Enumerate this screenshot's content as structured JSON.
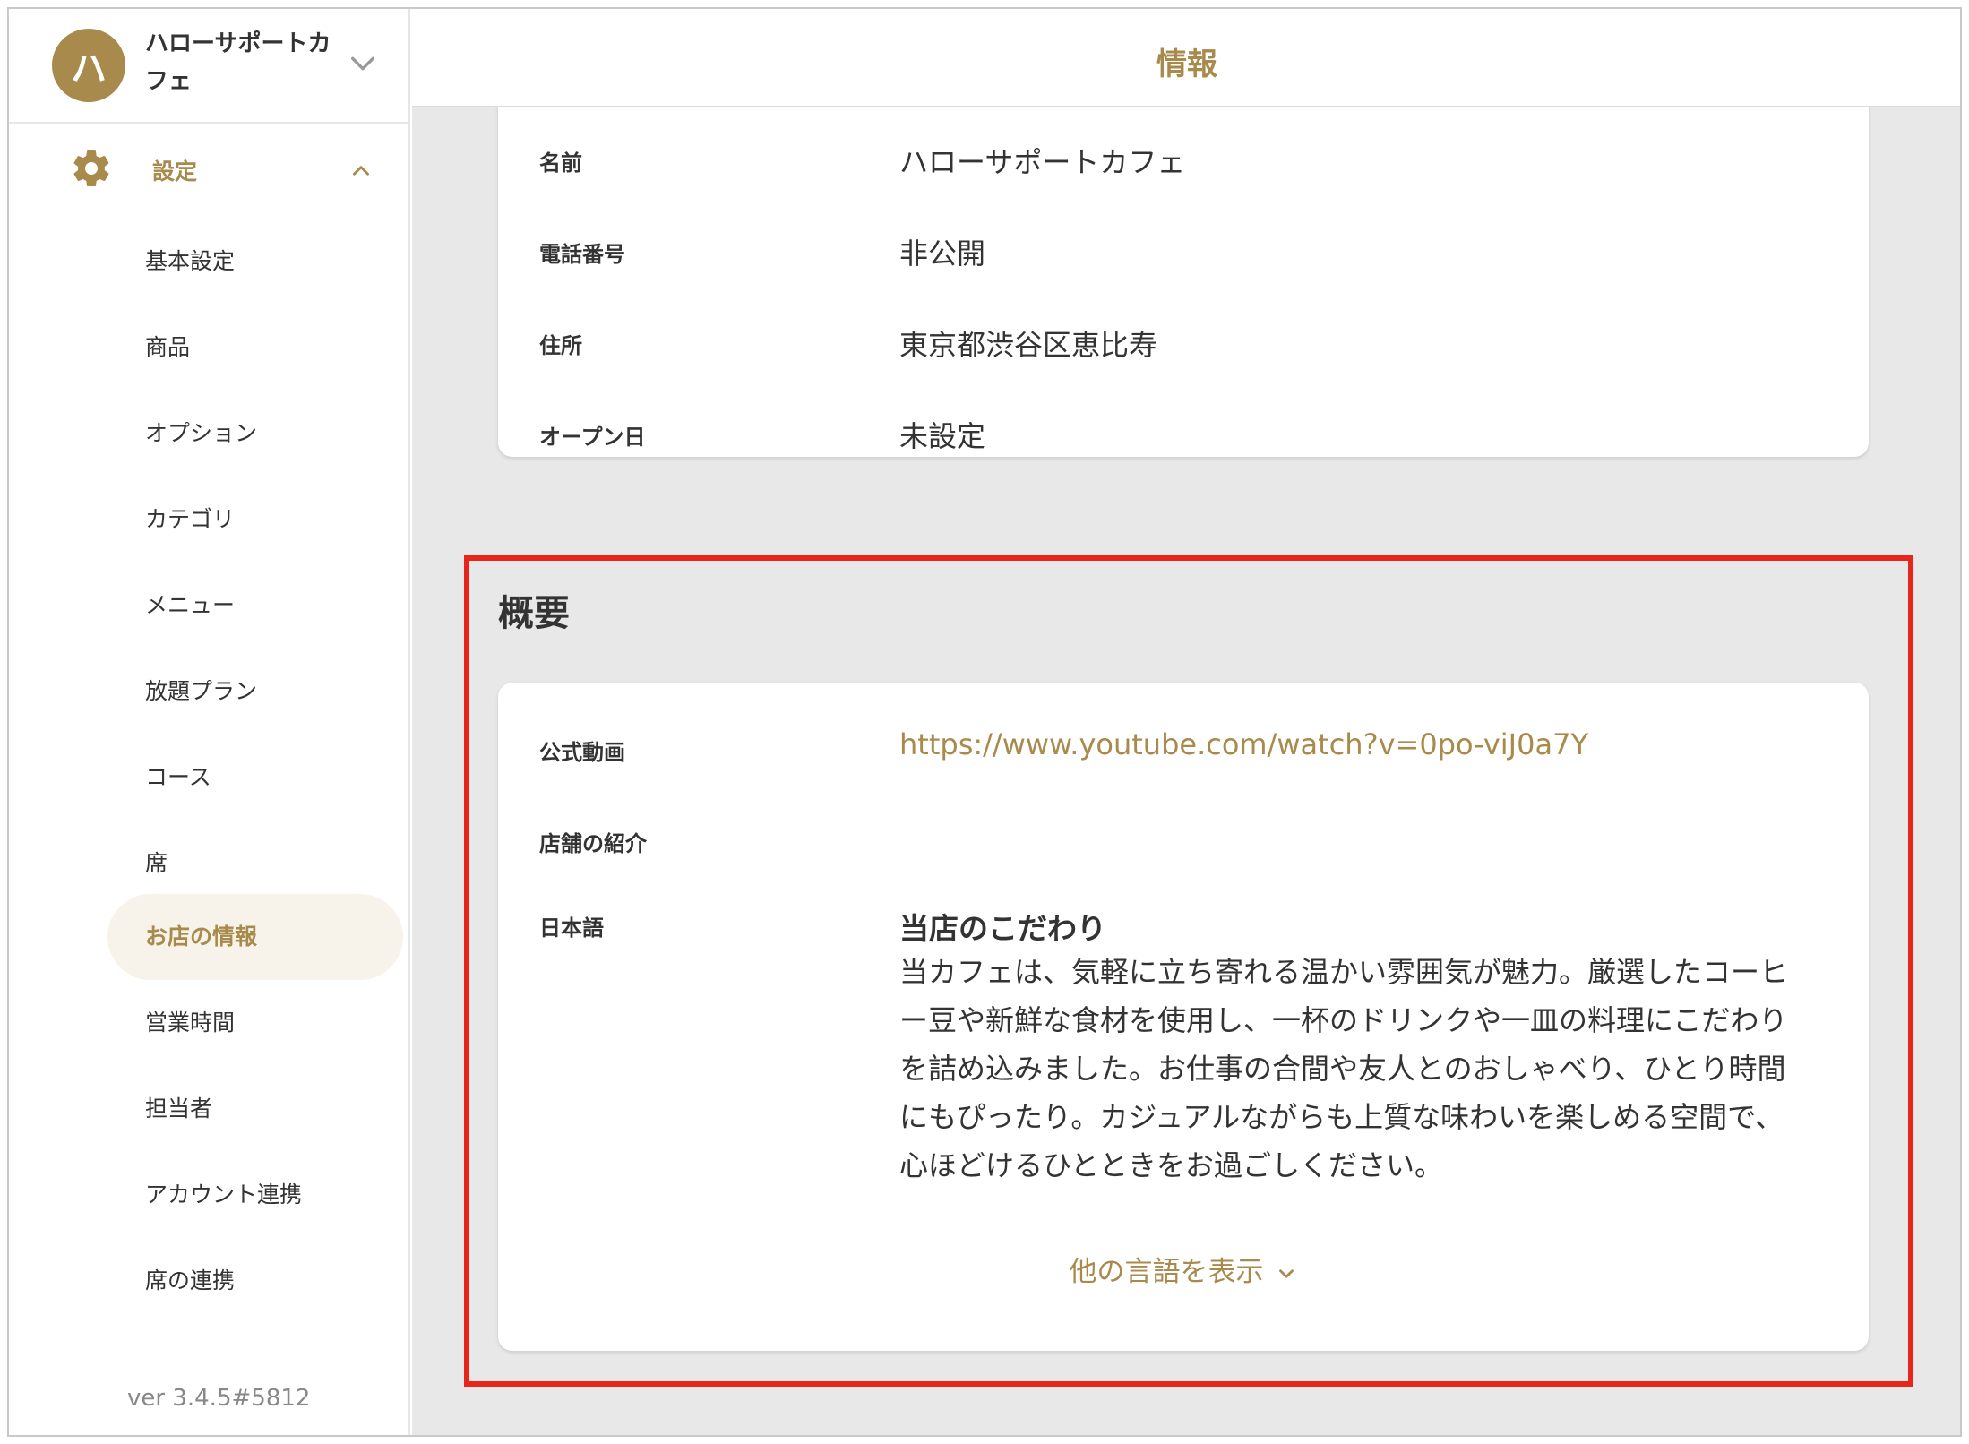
{
  "sidebar": {
    "store": {
      "avatar_letter": "ハ",
      "name": "ハローサポートカフェ"
    },
    "settings_label": "設定",
    "items": [
      {
        "label": "基本設定"
      },
      {
        "label": "商品"
      },
      {
        "label": "オプション"
      },
      {
        "label": "カテゴリ"
      },
      {
        "label": "メニュー"
      },
      {
        "label": "放題プラン"
      },
      {
        "label": "コース"
      },
      {
        "label": "席"
      },
      {
        "label": "お店の情報"
      },
      {
        "label": "営業時間"
      },
      {
        "label": "担当者"
      },
      {
        "label": "アカウント連携"
      },
      {
        "label": "席の連携"
      }
    ],
    "active_item": "お店の情報",
    "version": "ver 3.4.5#5812"
  },
  "header": {
    "title": "情報"
  },
  "basic_info": {
    "fields": [
      {
        "label": "名前",
        "value": "ハローサポートカフェ"
      },
      {
        "label": "電話番号",
        "value": "非公開"
      },
      {
        "label": "住所",
        "value": "東京都渋谷区恵比寿"
      },
      {
        "label": "オープン日",
        "value": "未設定"
      }
    ]
  },
  "overview": {
    "title": "概要",
    "video_label": "公式動画",
    "video_url": "https://www.youtube.com/watch?v=0po-viJ0a7Y",
    "intro_label": "店舗の紹介",
    "language_label": "日本語",
    "intro_heading": "当店のこだわり",
    "intro_body": "当カフェは、気軽に立ち寄れる温かい雰囲気が魅力。厳選したコーヒー豆や新鮮な食材を使用し、一杯のドリンクや一皿の料理にこだわりを詰め込みました。お仕事の合間や友人とのおしゃべり、ひとり時間にもぴったり。カジュアルながらも上質な味わいを楽しめる空間で、心ほどけるひとときをお過ごしください。",
    "show_more_label": "他の言語を表示"
  },
  "colors": {
    "accent": "#a88b4c",
    "highlight": "#e8251a",
    "background": "#e8e8e8"
  }
}
